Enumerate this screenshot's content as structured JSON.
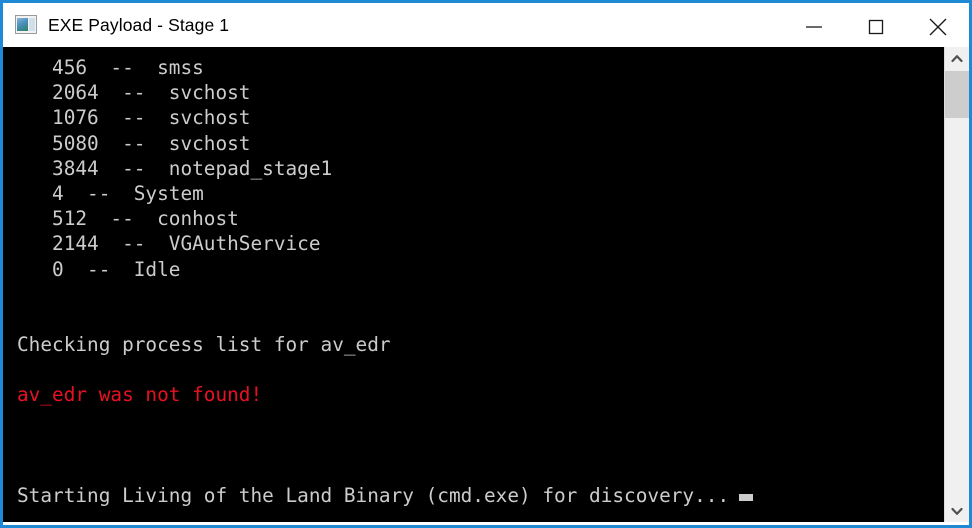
{
  "window": {
    "title": "EXE Payload - Stage 1",
    "icon": "console-window-icon",
    "border_color": "#1e8ad6",
    "titlebar_bg": "#ffffff",
    "controls": {
      "minimize_label": "Minimize",
      "maximize_label": "Maximize",
      "close_label": "Close"
    }
  },
  "terminal": {
    "background": "#000000",
    "foreground": "#cccccc",
    "error_color": "#e81123",
    "cursor": "block-cursor",
    "lines": [
      {
        "text": "   456  --  smss",
        "color": "normal"
      },
      {
        "text": "   2064  --  svchost",
        "color": "normal"
      },
      {
        "text": "   1076  --  svchost",
        "color": "normal"
      },
      {
        "text": "   5080  --  svchost",
        "color": "normal"
      },
      {
        "text": "   3844  --  notepad_stage1",
        "color": "normal"
      },
      {
        "text": "   4  --  System",
        "color": "normal"
      },
      {
        "text": "   512  --  conhost",
        "color": "normal"
      },
      {
        "text": "   2144  --  VGAuthService",
        "color": "normal"
      },
      {
        "text": "   0  --  Idle",
        "color": "normal"
      },
      {
        "text": "",
        "color": "normal"
      },
      {
        "text": "",
        "color": "normal"
      },
      {
        "text": "Checking process list for av_edr",
        "color": "normal"
      },
      {
        "text": "",
        "color": "normal"
      },
      {
        "text": "av_edr was not found!",
        "color": "error"
      },
      {
        "text": "",
        "color": "normal"
      },
      {
        "text": "",
        "color": "normal"
      },
      {
        "text": "",
        "color": "normal"
      },
      {
        "text": "Starting Living of the Land Binary (cmd.exe) for discovery...",
        "color": "normal",
        "cursor": true
      }
    ],
    "processes": [
      {
        "pid": "456",
        "sep": "--",
        "name": "smss"
      },
      {
        "pid": "2064",
        "sep": "--",
        "name": "svchost"
      },
      {
        "pid": "1076",
        "sep": "--",
        "name": "svchost"
      },
      {
        "pid": "5080",
        "sep": "--",
        "name": "svchost"
      },
      {
        "pid": "3844",
        "sep": "--",
        "name": "notepad_stage1"
      },
      {
        "pid": "4",
        "sep": "--",
        "name": "System"
      },
      {
        "pid": "512",
        "sep": "--",
        "name": "conhost"
      },
      {
        "pid": "2144",
        "sep": "--",
        "name": "VGAuthService"
      },
      {
        "pid": "0",
        "sep": "--",
        "name": "Idle"
      }
    ]
  },
  "scrollbar": {
    "up_arrow": "chevron-up-icon",
    "down_arrow": "chevron-down-icon",
    "thumb": "scrollbar-thumb"
  }
}
